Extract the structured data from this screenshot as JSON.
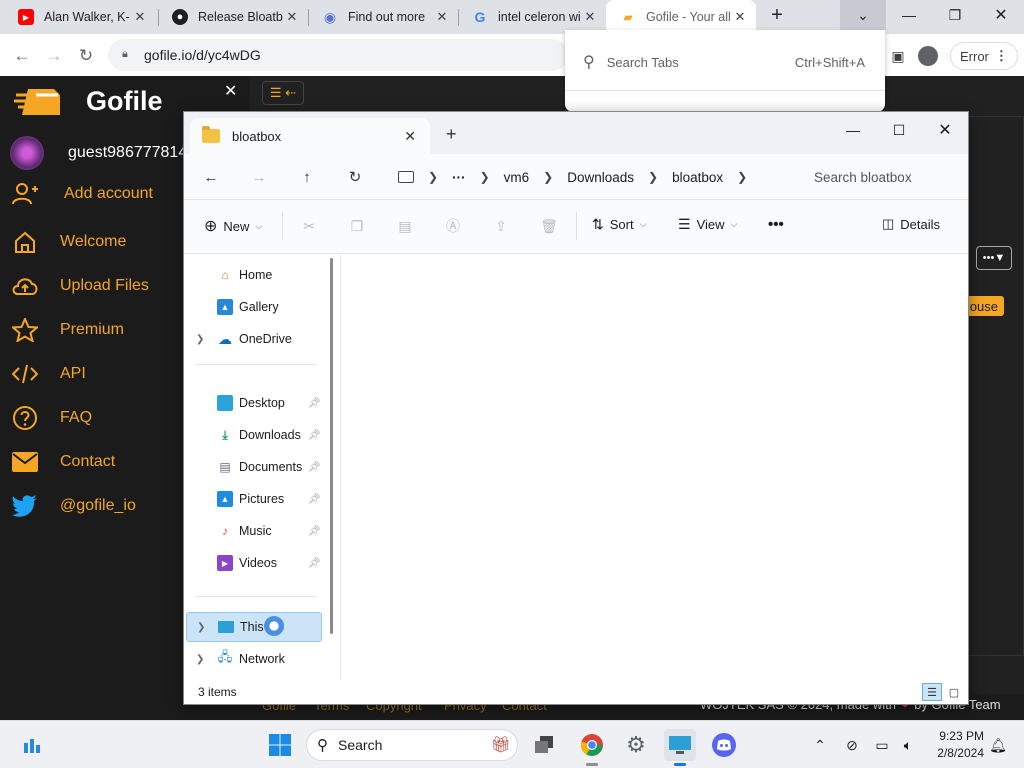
{
  "browser": {
    "tabs": [
      {
        "title": "Alan Walker, K-",
        "icon": "youtube-icon",
        "color": "#ff0000"
      },
      {
        "title": "Release Bloatb",
        "icon": "github-icon",
        "color": "#1b1f23"
      },
      {
        "title": "Find out more",
        "icon": "browser-tab-icon",
        "color": "#5a6fd6"
      },
      {
        "title": "intel celeron wi",
        "icon": "google-icon",
        "color": "#4285f4"
      },
      {
        "title": "Gofile - Your all",
        "icon": "gofile-icon",
        "color": "#f5a623"
      }
    ],
    "url": "gofile.io/d/yc4wDG",
    "profile_status": "Error",
    "tab_search": {
      "placeholder": "Search Tabs",
      "shortcut": "Ctrl+Shift+A"
    }
  },
  "gofile": {
    "brand": "Gofile",
    "user": "guest986777814",
    "menu": [
      {
        "label": "Add account",
        "icon": "add-user-icon"
      },
      {
        "label": "Welcome",
        "icon": "home-icon"
      },
      {
        "label": "Upload Files",
        "icon": "upload-cloud-icon"
      },
      {
        "label": "Premium",
        "icon": "star-icon"
      },
      {
        "label": "API",
        "icon": "code-icon"
      },
      {
        "label": "FAQ",
        "icon": "question-icon"
      },
      {
        "label": "Contact",
        "icon": "mail-icon"
      },
      {
        "label": "@gofile_io",
        "icon": "twitter-icon"
      }
    ],
    "footer": {
      "links": [
        "Gofile",
        "Terms",
        "Copyright",
        "Privacy",
        "Contact"
      ],
      "copyright": "WOJTEK SAS © 2024, made with",
      "team": "by Gofile Team"
    },
    "partial_button": "ouse",
    "accent": "#f5a623"
  },
  "explorer": {
    "tab_title": "bloatbox",
    "breadcrumb": [
      "vm6",
      "Downloads",
      "bloatbox"
    ],
    "search_placeholder": "Search bloatbox",
    "commands": {
      "new": "New",
      "sort": "Sort",
      "view": "View",
      "details": "Details"
    },
    "nav_pane": {
      "top": [
        {
          "label": "Home",
          "icon": "home-icon"
        },
        {
          "label": "Gallery",
          "icon": "gallery-icon"
        },
        {
          "label": "OneDrive",
          "icon": "cloud-icon"
        }
      ],
      "quick_access": [
        {
          "label": "Desktop",
          "icon": "desktop-icon"
        },
        {
          "label": "Downloads",
          "icon": "download-icon"
        },
        {
          "label": "Documents",
          "icon": "documents-icon"
        },
        {
          "label": "Pictures",
          "icon": "pictures-icon"
        },
        {
          "label": "Music",
          "icon": "music-icon"
        },
        {
          "label": "Videos",
          "icon": "videos-icon"
        }
      ],
      "bottom": [
        {
          "label": "This PC",
          "icon": "this-pc-icon"
        },
        {
          "label": "Network",
          "icon": "network-icon"
        }
      ]
    },
    "status": "3 items"
  },
  "taskbar": {
    "search": "Search",
    "time": "9:23 PM",
    "date": "2/8/2024"
  }
}
